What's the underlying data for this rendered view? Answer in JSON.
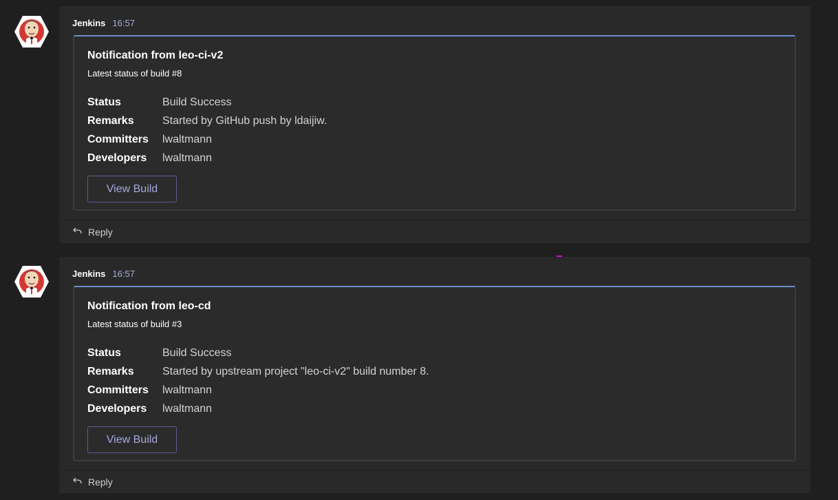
{
  "colors": {
    "background": "#1f1f1f",
    "message_bg": "#292929",
    "card_accent": "#6a8fc9",
    "timestamp": "#a9b0d8",
    "button_text": "#a6a8dc",
    "button_border": "#5b5f92"
  },
  "messages": [
    {
      "sender": "Jenkins",
      "time": "16:57",
      "card": {
        "title": "Notification from leo-ci-v2",
        "subtitle": "Latest status of build #8",
        "facts": [
          {
            "key": "Status",
            "value": "Build Success"
          },
          {
            "key": "Remarks",
            "value": "Started by GitHub push by ldaijiw."
          },
          {
            "key": "Committers",
            "value": "lwaltmann"
          },
          {
            "key": "Developers",
            "value": "lwaltmann"
          }
        ],
        "button_label": "View Build"
      },
      "reply_label": "Reply",
      "reply_icon": "reply-arrow-icon",
      "avatar_icon": "jenkins-avatar-icon"
    },
    {
      "sender": "Jenkins",
      "time": "16:57",
      "card": {
        "title": "Notification from leo-cd",
        "subtitle": "Latest status of build #3",
        "facts": [
          {
            "key": "Status",
            "value": "Build Success"
          },
          {
            "key": "Remarks",
            "value": "Started by upstream project \"leo-ci-v2\" build number 8."
          },
          {
            "key": "Committers",
            "value": "lwaltmann"
          },
          {
            "key": "Developers",
            "value": "lwaltmann"
          }
        ],
        "button_label": "View Build"
      },
      "reply_label": "Reply",
      "reply_icon": "reply-arrow-icon",
      "avatar_icon": "jenkins-avatar-icon"
    }
  ]
}
